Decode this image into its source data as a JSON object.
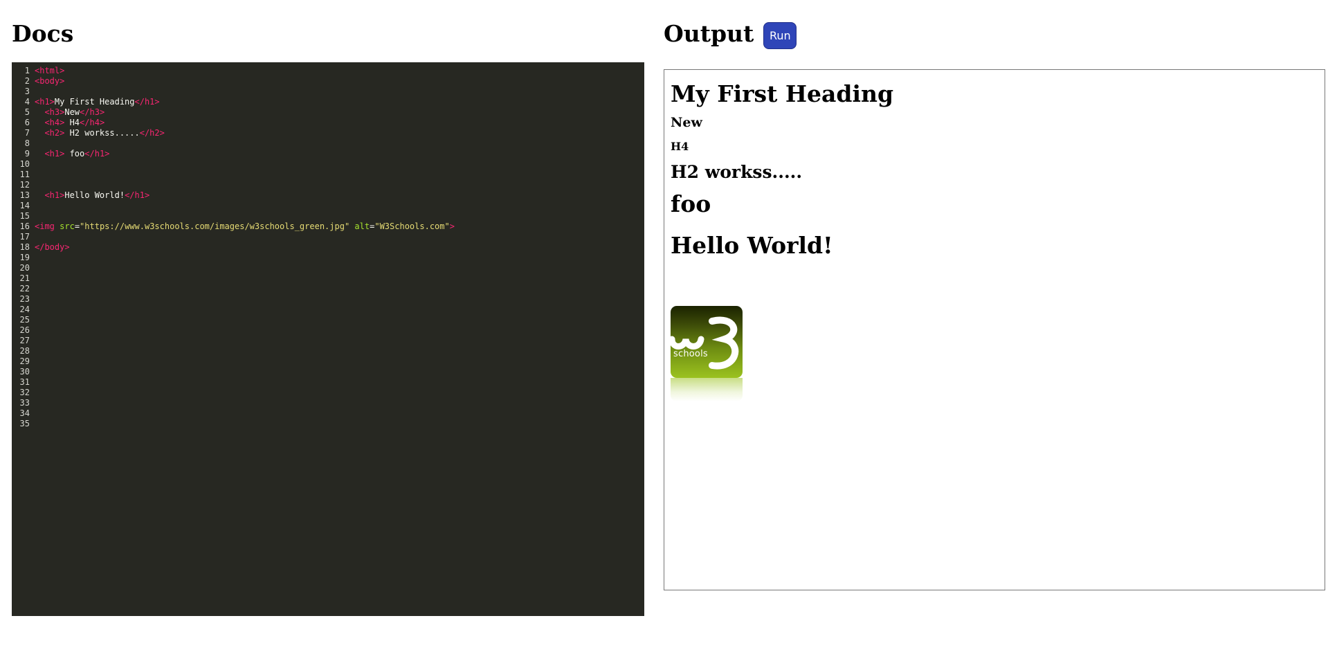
{
  "docs_panel": {
    "title": "Docs"
  },
  "output_panel": {
    "title": "Output",
    "run_label": "Run"
  },
  "editor": {
    "lines": [
      {
        "num": "1",
        "tokens": [
          {
            "t": "tag",
            "v": "<html>"
          }
        ]
      },
      {
        "num": "2",
        "tokens": [
          {
            "t": "tag",
            "v": "<body>"
          }
        ]
      },
      {
        "num": "3",
        "tokens": []
      },
      {
        "num": "4",
        "tokens": [
          {
            "t": "tag",
            "v": "<h1>"
          },
          {
            "t": "text",
            "v": "My First Heading"
          },
          {
            "t": "tag",
            "v": "</h1>"
          }
        ]
      },
      {
        "num": "5",
        "tokens": [
          {
            "t": "text",
            "v": "  "
          },
          {
            "t": "tag",
            "v": "<h3>"
          },
          {
            "t": "text",
            "v": "New"
          },
          {
            "t": "tag",
            "v": "</h3>"
          }
        ]
      },
      {
        "num": "6",
        "tokens": [
          {
            "t": "text",
            "v": "  "
          },
          {
            "t": "tag",
            "v": "<h4>"
          },
          {
            "t": "text",
            "v": " H4"
          },
          {
            "t": "tag",
            "v": "</h4>"
          }
        ]
      },
      {
        "num": "7",
        "tokens": [
          {
            "t": "text",
            "v": "  "
          },
          {
            "t": "tag",
            "v": "<h2>"
          },
          {
            "t": "text",
            "v": " H2 workss....."
          },
          {
            "t": "tag",
            "v": "</h2>"
          }
        ]
      },
      {
        "num": "8",
        "tokens": []
      },
      {
        "num": "9",
        "tokens": [
          {
            "t": "text",
            "v": "  "
          },
          {
            "t": "tag",
            "v": "<h1>"
          },
          {
            "t": "text",
            "v": " foo"
          },
          {
            "t": "tag",
            "v": "</h1>"
          }
        ]
      },
      {
        "num": "10",
        "tokens": []
      },
      {
        "num": "11",
        "tokens": []
      },
      {
        "num": "12",
        "tokens": []
      },
      {
        "num": "13",
        "tokens": [
          {
            "t": "text",
            "v": "  "
          },
          {
            "t": "tag",
            "v": "<h1>"
          },
          {
            "t": "text",
            "v": "Hello World!"
          },
          {
            "t": "tag",
            "v": "</h1>"
          }
        ]
      },
      {
        "num": "14",
        "tokens": []
      },
      {
        "num": "15",
        "tokens": []
      },
      {
        "num": "16",
        "tokens": [
          {
            "t": "tag",
            "v": "<img "
          },
          {
            "t": "attr",
            "v": "src"
          },
          {
            "t": "text",
            "v": "="
          },
          {
            "t": "str",
            "v": "\"https://www.w3schools.com/images/w3schools_green.jpg\""
          },
          {
            "t": "text",
            "v": " "
          },
          {
            "t": "attr",
            "v": "alt"
          },
          {
            "t": "text",
            "v": "="
          },
          {
            "t": "str",
            "v": "\"W3Schools.com\""
          },
          {
            "t": "tag",
            "v": ">"
          }
        ]
      },
      {
        "num": "17",
        "tokens": []
      },
      {
        "num": "18",
        "tokens": [
          {
            "t": "tag",
            "v": "</body>"
          }
        ]
      },
      {
        "num": "19",
        "tokens": []
      },
      {
        "num": "20",
        "tokens": []
      },
      {
        "num": "21",
        "tokens": []
      },
      {
        "num": "22",
        "tokens": []
      },
      {
        "num": "23",
        "tokens": []
      },
      {
        "num": "24",
        "tokens": []
      },
      {
        "num": "25",
        "tokens": []
      },
      {
        "num": "26",
        "tokens": []
      },
      {
        "num": "27",
        "tokens": []
      },
      {
        "num": "28",
        "tokens": []
      },
      {
        "num": "29",
        "tokens": []
      },
      {
        "num": "30",
        "tokens": []
      },
      {
        "num": "31",
        "tokens": []
      },
      {
        "num": "32",
        "tokens": []
      },
      {
        "num": "33",
        "tokens": []
      },
      {
        "num": "34",
        "tokens": []
      },
      {
        "num": "35",
        "tokens": []
      }
    ]
  },
  "output": {
    "heading1": "My First Heading",
    "heading_new": "New",
    "heading_h4": "H4",
    "heading_h2": "H2 workss.....",
    "heading_foo": "foo",
    "heading_hello": "Hello World!",
    "logo_text": "schools",
    "logo_mark": "w3"
  },
  "colors": {
    "editor_bg": "#272822",
    "tag": "#f92672",
    "attr": "#a6e22e",
    "string": "#e6db74",
    "run_button": "#2f45b8"
  }
}
